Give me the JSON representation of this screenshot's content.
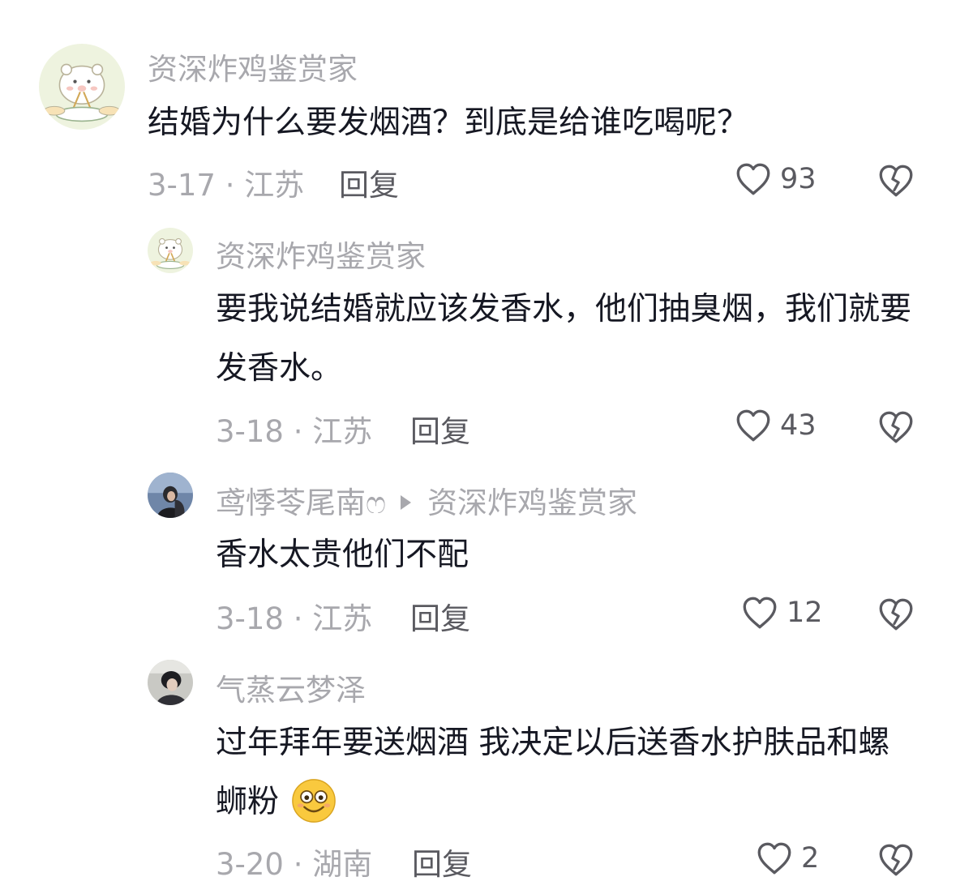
{
  "comments": [
    {
      "username": "资深炸鸡鉴赏家",
      "text": "结婚为什么要发烟酒？到底是给谁吃喝呢？",
      "date_location": "3-17 · 江苏",
      "reply_label": "回复",
      "likes": "93"
    },
    {
      "username": "资深炸鸡鉴赏家",
      "text": "要我说结婚就应该发香水，他们抽臭烟，我们就要发香水。",
      "date_location": "3-18 · 江苏",
      "reply_label": "回复",
      "likes": "43"
    },
    {
      "username": "鸢悸苓尾南ෆ",
      "reply_to": "资深炸鸡鉴赏家",
      "text": "香水太贵他们不配",
      "date_location": "3-18 · 江苏",
      "reply_label": "回复",
      "likes": "12"
    },
    {
      "username": "气蒸云梦泽",
      "text": "过年拜年要送烟酒 我决定以后送香水护肤品和螺蛳粉",
      "date_location": "3-20 · 湖南",
      "reply_label": "回复",
      "likes": "2"
    }
  ],
  "icons": {
    "like": "heart-outline-icon",
    "dislike": "broken-heart-icon",
    "emoji": "smile-emoji-icon"
  },
  "colors": {
    "secondary_text": "#a8a8ad",
    "primary_text": "#161823",
    "action_text": "#5a5a60"
  }
}
